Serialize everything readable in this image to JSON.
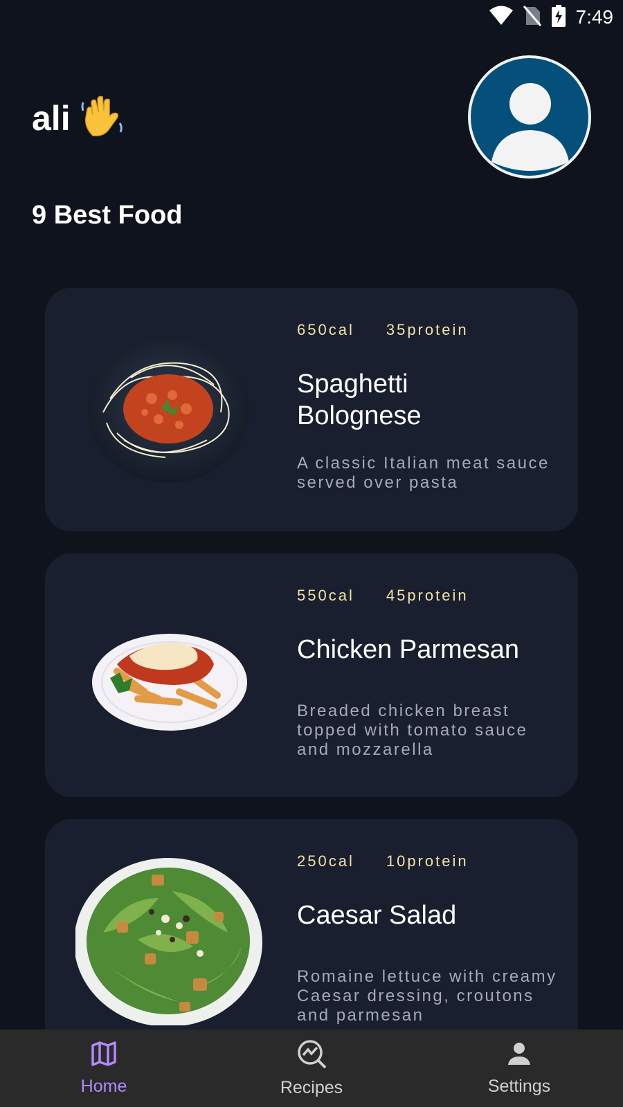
{
  "status_bar": {
    "time": "7:49"
  },
  "header": {
    "user_name": "ali",
    "wave_emoji": "👋"
  },
  "section_title": "9 Best Food",
  "foods": [
    {
      "calories": "650cal",
      "protein": "35protein",
      "name": "Spaghetti Bolognese",
      "description": "A classic Italian meat sauce served over pasta"
    },
    {
      "calories": "550cal",
      "protein": "45protein",
      "name": "Chicken Parmesan",
      "description": "Breaded chicken breast topped with tomato sauce and mozzarella"
    },
    {
      "calories": "250cal",
      "protein": "10protein",
      "name": "Caesar Salad",
      "description": "Romaine lettuce with creamy Caesar dressing, croutons and parmesan"
    }
  ],
  "bottom_nav": [
    {
      "label": "Home",
      "icon": "map-icon",
      "active": true
    },
    {
      "label": "Recipes",
      "icon": "chart-search-icon",
      "active": false
    },
    {
      "label": "Settings",
      "icon": "person-icon",
      "active": false
    }
  ],
  "colors": {
    "background": "#0f131d",
    "card": "#1a1f30",
    "accent": "#b388ff",
    "stats": "#f3e2a6"
  }
}
